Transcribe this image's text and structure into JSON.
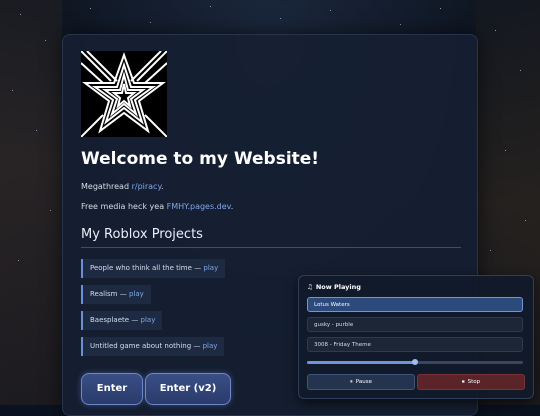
{
  "header": {
    "title": "Welcome to my Website!",
    "line1_prefix": "Megathread ",
    "line1_link": "r/piracy",
    "line1_suffix": ".",
    "line2_prefix": "Free media heck yea ",
    "line2_link": "FMHY.pages.dev",
    "line2_suffix": "."
  },
  "projects": {
    "heading": "My Roblox Projects",
    "play_label": "play",
    "separator": " — ",
    "items": [
      {
        "name": "People who think all the time"
      },
      {
        "name": "Realism"
      },
      {
        "name": "Baesplaete"
      },
      {
        "name": "Untitled game about nothing"
      }
    ]
  },
  "buttons": {
    "enter": "Enter",
    "enter_v2": "Enter (v2)"
  },
  "player": {
    "title": "Now Playing",
    "note_icon": "♫",
    "tracks": [
      "Lotus Waters",
      "gusky - purble",
      "3008 - Friday Theme"
    ],
    "active_track_index": 0,
    "progress": 0.5,
    "pause_label": "Pause",
    "stop_label": "Stop",
    "pause_icon": "⏸",
    "stop_icon": "⏹"
  },
  "colors": {
    "accent": "#7fa6e8",
    "button": "#3a4f86",
    "stop": "#5a2428"
  }
}
